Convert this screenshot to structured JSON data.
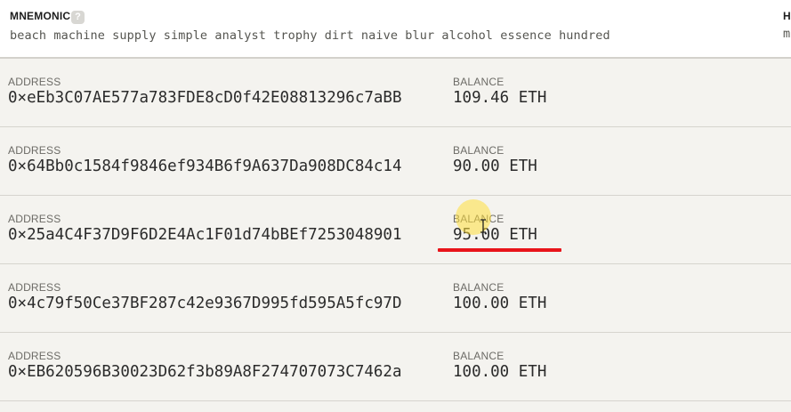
{
  "mnemonic": {
    "title": "MNEMONIC",
    "help_icon": "?",
    "words": "beach machine supply simple analyst trophy dirt naive blur alcohol essence hundred"
  },
  "hd_path": {
    "title_cut": "H",
    "value_cut": "m"
  },
  "accounts": [
    {
      "address_label": "ADDRESS",
      "address": "0×eEb3C07AE577a783FDE8cD0f42E08813296c7aBB",
      "balance_label": "BALANCE",
      "balance": "109.46 ETH"
    },
    {
      "address_label": "ADDRESS",
      "address": "0×64Bb0c1584f9846ef934B6f9A637Da908DC84c14",
      "balance_label": "BALANCE",
      "balance": "90.00 ETH"
    },
    {
      "address_label": "ADDRESS",
      "address": "0×25a4C4F37D9F6D2E4Ac1F01d74bBEf7253048901",
      "balance_label": "BALANCE",
      "balance": "95.00 ETH"
    },
    {
      "address_label": "ADDRESS",
      "address": "0×4c79f50Ce37BF287c42e9367D995fd595A5fc97D",
      "balance_label": "BALANCE",
      "balance": "100.00 ETH"
    },
    {
      "address_label": "ADDRESS",
      "address": "0×EB620596B30023D62f3b89A8F274707073C7462a",
      "balance_label": "BALANCE",
      "balance": "100.00 ETH"
    }
  ],
  "colors": {
    "background": "#f4f3ef",
    "header_background": "#ffffff",
    "annotation_underline": "#e8141a",
    "cursor_highlight": "#ffde3c"
  },
  "icons": {
    "help": "help-icon",
    "cursor": "text-cursor-icon"
  }
}
